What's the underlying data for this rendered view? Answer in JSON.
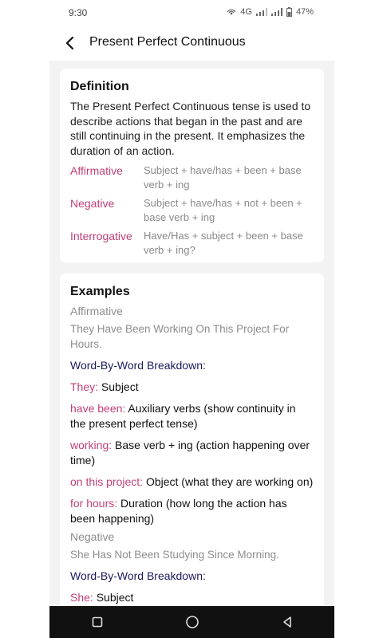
{
  "status": {
    "time": "9:30",
    "network": "4G",
    "battery": "47%"
  },
  "header": {
    "title": "Present Perfect Continuous"
  },
  "definition": {
    "heading": "Definition",
    "text": "The Present Perfect Continuous tense is used to describe actions that began in the past and are still continuing in the present. It emphasizes the duration of an action.",
    "forms": [
      {
        "label": "Affirmative",
        "value": "Subject + have/has + been + base verb + ing"
      },
      {
        "label": "Negative",
        "value": "Subject + have/has + not + been + base verb + ing"
      },
      {
        "label": "Interrogative",
        "value": "Have/Has + subject + been + base verb + ing?"
      }
    ]
  },
  "examples": {
    "heading": "Examples",
    "affirmative": {
      "label": "Affirmative",
      "sentence": "They Have Been Working On This Project For Hours.",
      "breakdown_title": "Word-By-Word Breakdown:",
      "items": [
        {
          "key": "They:",
          "desc": " Subject"
        },
        {
          "key": "have been:",
          "desc": " Auxiliary verbs (show continuity in the present perfect tense)"
        },
        {
          "key": "working:",
          "desc": " Base verb + ing (action happening over time)"
        },
        {
          "key": "on this project:",
          "desc": " Object (what they are working on)"
        },
        {
          "key": "for hours:",
          "desc": " Duration (how long the action has been happening)"
        }
      ]
    },
    "negative": {
      "label": "Negative",
      "sentence": "She Has Not Been Studying Since Morning.",
      "breakdown_title": "Word-By-Word Breakdown:",
      "items": [
        {
          "key": "She:",
          "desc": " Subject"
        }
      ]
    }
  }
}
